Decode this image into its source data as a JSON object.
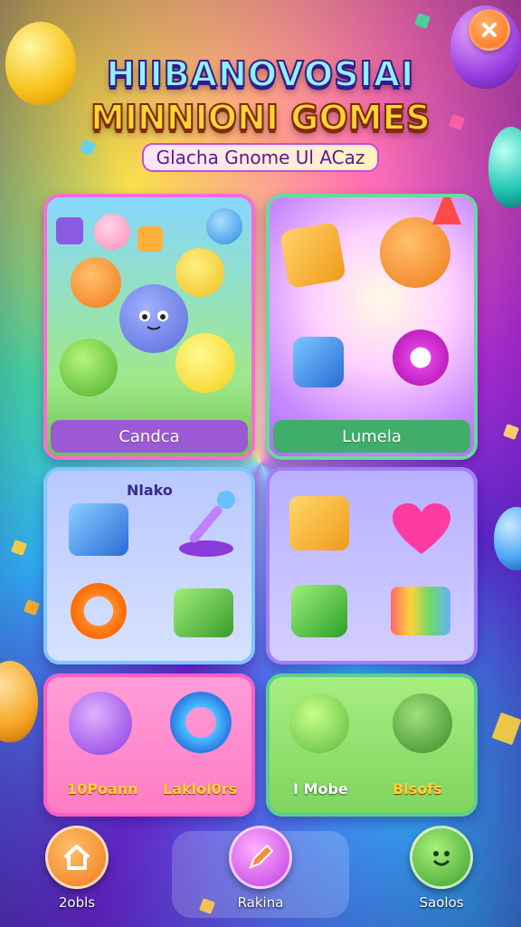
{
  "header": {
    "title_line1": "HIIBANOVOSIAI",
    "title_line2": "MINNIONI GOMES",
    "subtitle": "Glacha Gnome Ul ACaz",
    "close_icon": "close-icon"
  },
  "cards": {
    "top_left_label": "Candca",
    "top_right_label": "Lumela",
    "mid_left_title": "Nlako"
  },
  "pink_card": {
    "label_left": "10Poann",
    "label_right": "Laklol0rs"
  },
  "green_card": {
    "label_left": "I Mobe",
    "label_right": "Blsofs"
  },
  "nav": {
    "item_left_label": "2obls",
    "item_mid_label": "Rakina",
    "item_right_label": "Saolos",
    "item_left_icon": "home-icon",
    "item_mid_icon": "pencil-icon",
    "item_right_icon": "smiley-icon"
  },
  "colors": {
    "purple_label": "#9b59d6",
    "green_label": "#3fae6a",
    "pink_card": "#ff8fd0",
    "green_card": "#9be07a",
    "blue_card": "#9fb6ff"
  }
}
